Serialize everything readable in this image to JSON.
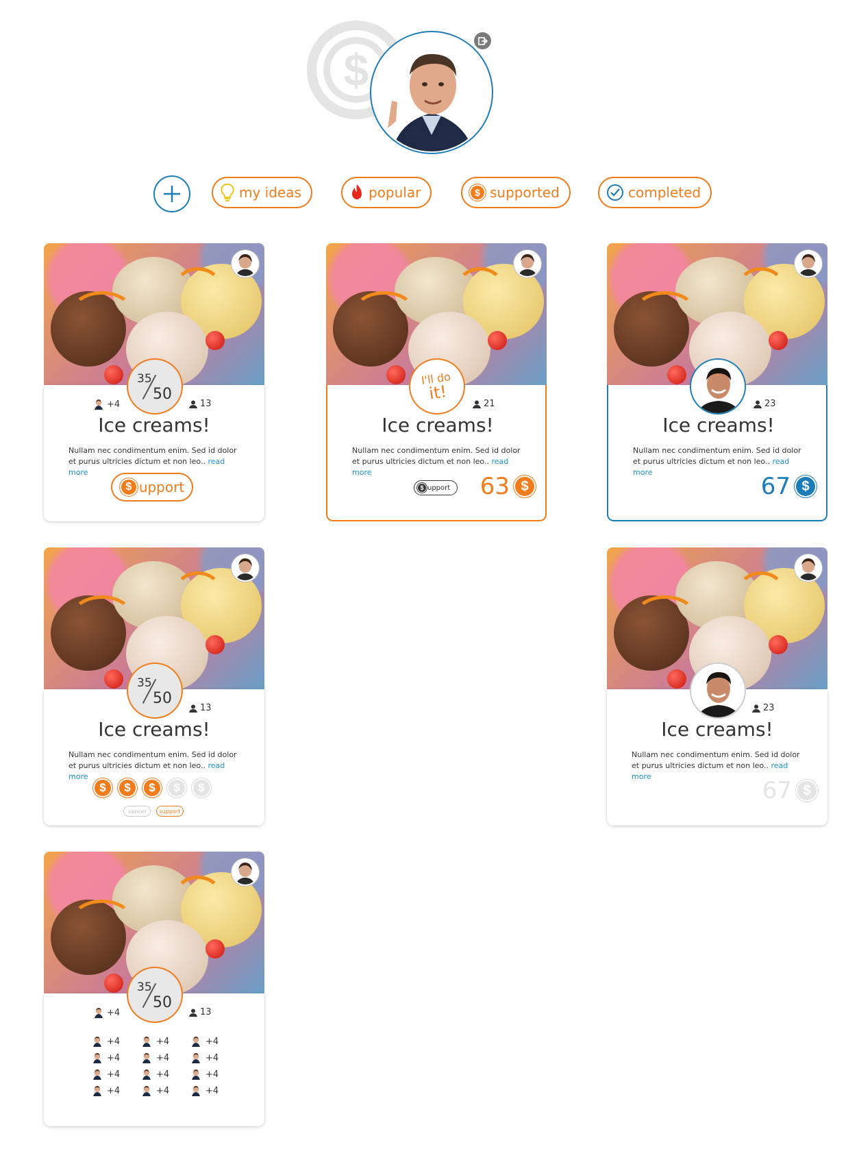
{
  "header": {
    "logout_icon": "logout-icon",
    "coin_symbol": "$"
  },
  "filters": [
    {
      "label": "my ideas",
      "icon": "lightbulb-icon"
    },
    {
      "label": "popular",
      "icon": "flame-icon"
    },
    {
      "label": "supported",
      "icon": "coin-icon"
    },
    {
      "label": "completed",
      "icon": "check-circle-icon"
    }
  ],
  "colors": {
    "accent": "#f07c1c",
    "blue": "#1c7cb8",
    "link": "#1c8fd0",
    "muted": "#e4e4e4"
  },
  "coin_symbol": "$",
  "card": {
    "title": "Ice creams!",
    "desc": "Nullam nec condimentum enim. Sed id dolor et purus ultricies dictum et non leo..",
    "read_more": "read more"
  },
  "cards": {
    "c1": {
      "progress_num": "35",
      "progress_den": "50",
      "team_extra": "+4",
      "supporters": "13",
      "support_label": "upport"
    },
    "c2": {
      "doit_l1": "I'll do",
      "doit_l2": "it!",
      "supporters": "21",
      "support_label": "upport",
      "total": "63"
    },
    "c3": {
      "supporters": "23",
      "total": "67"
    },
    "c4": {
      "progress_num": "35",
      "progress_den": "50",
      "supporters": "13",
      "cancel": "cancel",
      "support": "support",
      "coins_selected": 3,
      "coins_total": 5
    },
    "c5": {
      "supporters": "23",
      "total": "67"
    },
    "c6": {
      "progress_num": "35",
      "progress_den": "50",
      "team_extra": "+4",
      "supporters": "13",
      "team_grid": [
        "+4",
        "+4",
        "+4",
        "+4",
        "+4",
        "+4",
        "+4",
        "+4",
        "+4",
        "+4",
        "+4",
        "+4"
      ]
    }
  }
}
